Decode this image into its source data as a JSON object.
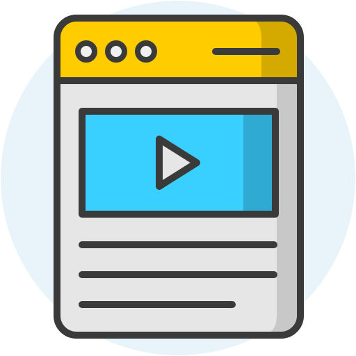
{
  "icon": {
    "name": "video-webpage-icon",
    "colors": {
      "background_circle": "#E8F3FA",
      "outline": "#3A3A3A",
      "header_yellow": "#FFCC00",
      "header_yellow_shade": "#D4AA00",
      "page_gray": "#E6E6E6",
      "page_gray_shade": "#C8C8C8",
      "video_blue": "#39D0FF",
      "video_blue_shade": "#2FAAD3",
      "dot_fill": "#F0F0F0"
    },
    "window_dots": 3,
    "text_lines": 3
  }
}
